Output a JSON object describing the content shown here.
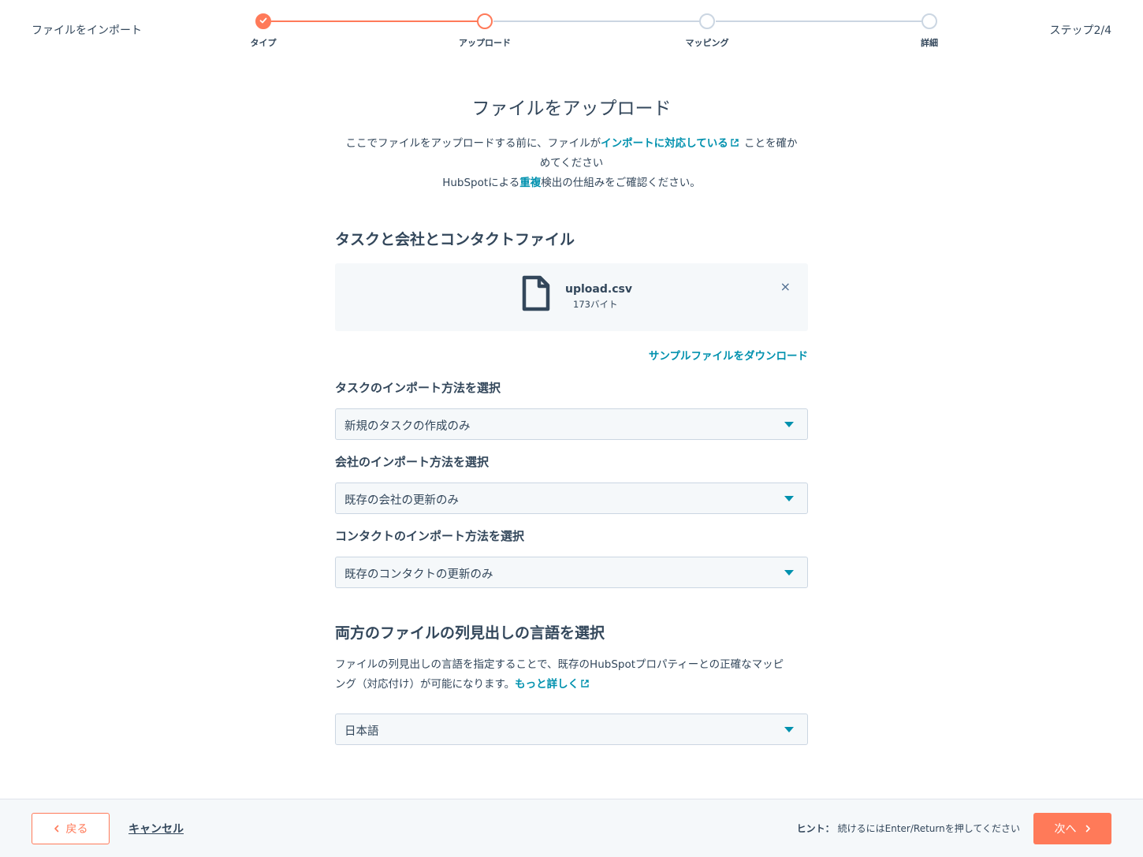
{
  "header": {
    "title": "ファイルをインポート",
    "step_counter": "ステップ2/4",
    "steps": [
      {
        "label": "タイプ",
        "state": "done"
      },
      {
        "label": "アップロード",
        "state": "active"
      },
      {
        "label": "マッピング",
        "state": "pending"
      },
      {
        "label": "詳細",
        "state": "pending"
      }
    ]
  },
  "main": {
    "title": "ファイルをアップロード",
    "intro_line1_pre": "ここでファイルをアップロードする前に、ファイルが",
    "intro_line1_link": "インポートに対応している",
    "intro_line1_post": "ことを確か",
    "intro_line2": "めてください",
    "intro_line3_pre": "HubSpotによる",
    "intro_line3_link": "重複",
    "intro_line3_post": "検出の仕組みをご確認ください。",
    "file_section_title": "タスクと会社とコンタクトファイル",
    "file": {
      "name": "upload.csv",
      "size": "173バイト",
      "remove": "×"
    },
    "sample_link": "サンプルファイルをダウンロード",
    "task_import": {
      "label": "タスクのインポート方法を選択",
      "value": "新規のタスクの作成のみ"
    },
    "company_import": {
      "label": "会社のインポート方法を選択",
      "value": "既存の会社の更新のみ"
    },
    "contact_import": {
      "label": "コンタクトのインポート方法を選択",
      "value": "既存のコンタクトの更新のみ"
    },
    "language_section_title": "両方のファイルの列見出しの言語を選択",
    "language_desc_line1": "ファイルの列見出しの言語を指定することで、既存のHubSpotプロパティーとの正確なマッピ",
    "language_desc_line2_pre": "ング（対応付け）が可能になります。",
    "language_desc_link": "もっと詳しく",
    "language_select": {
      "value": "日本語"
    }
  },
  "footer": {
    "back_label": "戻る",
    "cancel_label": "キャンセル",
    "hint_label": "ヒント：",
    "hint_text": "続けるにはEnter/Returnを押してください",
    "next_label": "次へ"
  },
  "colors": {
    "accent": "#ff7a59",
    "link": "#0091ae",
    "text": "#33475b",
    "bg_light": "#f5f8fa",
    "border": "#cbd6e2"
  }
}
